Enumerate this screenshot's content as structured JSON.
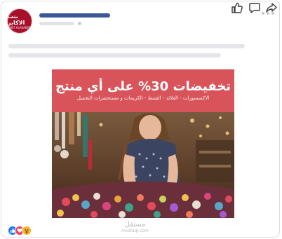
{
  "post": {
    "avatar": {
      "logo_text": "بنت الاكابر",
      "logo_subtext": "BINT ALAKABER"
    },
    "ad": {
      "headline": "تخفيضات 30% على أي منتج",
      "subline": "الاكسسورات - القلائد - الشنط - الكريمات و مستحضرات التجميل"
    }
  },
  "watermark": {
    "brand": "مستقل",
    "url": "mostaql.com"
  },
  "reactions": [
    "like-icon",
    "love-icon",
    "wow-icon"
  ],
  "actions": [
    "like-icon",
    "comment-icon",
    "share-icon"
  ],
  "colors": {
    "brand_red": "#a8102a",
    "banner": "#d8545a",
    "name_bar": "#3b5998",
    "like_blue": "#1877f2"
  }
}
